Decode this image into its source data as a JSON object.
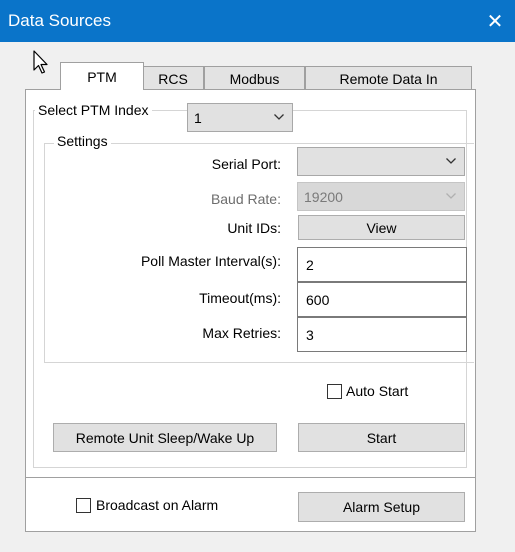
{
  "window": {
    "title": "Data Sources",
    "close_glyph": "✕"
  },
  "tabs": [
    {
      "label": "PTM",
      "active": true
    },
    {
      "label": "RCS"
    },
    {
      "label": "Modbus"
    },
    {
      "label": "Remote Data In"
    }
  ],
  "select_index": {
    "label": "Select PTM Index",
    "value": "1"
  },
  "settings": {
    "legend": "Settings",
    "serial_port": {
      "label": "Serial Port:",
      "value": ""
    },
    "baud_rate": {
      "label": "Baud Rate:",
      "value": "19200"
    },
    "unit_ids": {
      "label": "Unit IDs:",
      "button": "View"
    },
    "poll_master": {
      "label": "Poll Master Interval(s):",
      "value": "2"
    },
    "timeout": {
      "label": "Timeout(ms):",
      "value": "600"
    },
    "max_retries": {
      "label": "Max Retries:",
      "value": "3"
    }
  },
  "auto_start": {
    "label": "Auto Start",
    "checked": false
  },
  "buttons": {
    "sleep_wake": "Remote Unit Sleep/Wake Up",
    "start": "Start"
  },
  "alarm": {
    "broadcast": {
      "label": "Broadcast on Alarm",
      "checked": false
    },
    "setup_button": "Alarm Setup"
  },
  "colors": {
    "titlebar": "#0a74c9",
    "panel": "#ffffff",
    "client": "#f0f0f0"
  }
}
